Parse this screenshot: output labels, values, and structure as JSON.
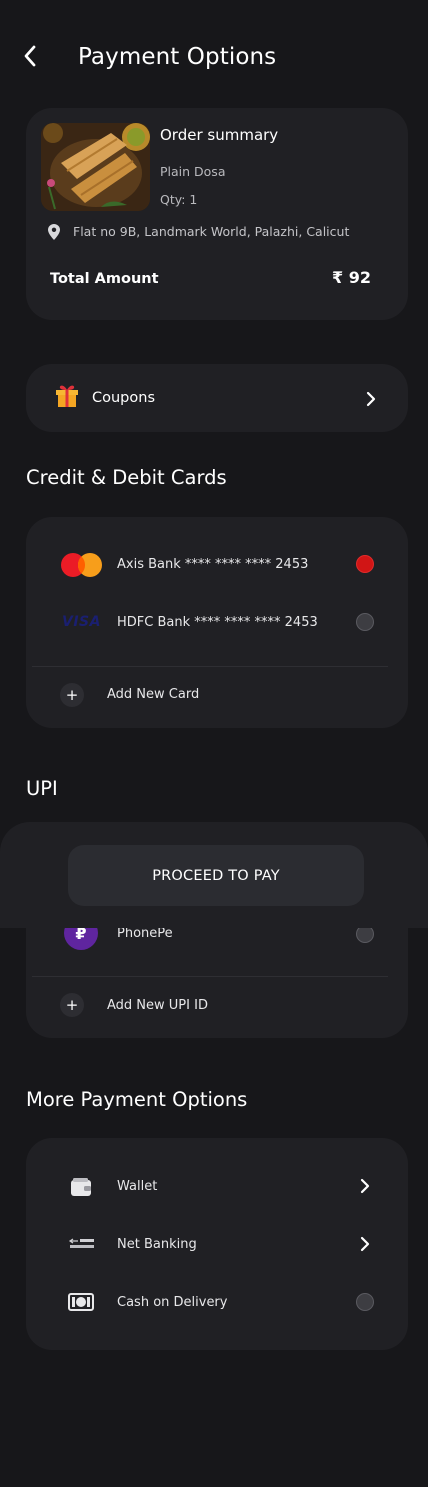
{
  "header": {
    "title": "Payment Options"
  },
  "order": {
    "title": "Order summary",
    "item": "Plain Dosa",
    "qty": "Qty: 1",
    "address": "Flat no 9B, Landmark World, Palazhi, Calicut",
    "total_label": "Total Amount",
    "total_value": "₹ 92"
  },
  "coupons": {
    "label": "Coupons"
  },
  "cards_section": {
    "title": "Credit & Debit Cards",
    "cards": [
      {
        "label": "Axis Bank **** **** **** 2453",
        "brand": "mastercard-icon",
        "selected": true
      },
      {
        "label": "HDFC Bank **** **** **** 2453",
        "brand": "visa-icon",
        "selected": false
      }
    ],
    "add_label": "Add New Card",
    "visa_text": "VISA"
  },
  "upi_section": {
    "title": "UPI",
    "apps": [
      {
        "label": "PhonePe",
        "selected": false
      }
    ],
    "add_label": "Add New UPI ID"
  },
  "proceed": {
    "label": "PROCEED TO PAY"
  },
  "more_section": {
    "title": "More Payment Options",
    "options": [
      {
        "label": "Wallet",
        "icon": "wallet-icon"
      },
      {
        "label": "Net Banking",
        "icon": "bank-transfer-icon"
      },
      {
        "label": "Cash on Delivery",
        "icon": "cash-icon"
      }
    ]
  },
  "colors": {
    "background": "#17171a",
    "card": "#202024",
    "accent_red": "#d11515",
    "phonepe": "#5f259f"
  }
}
